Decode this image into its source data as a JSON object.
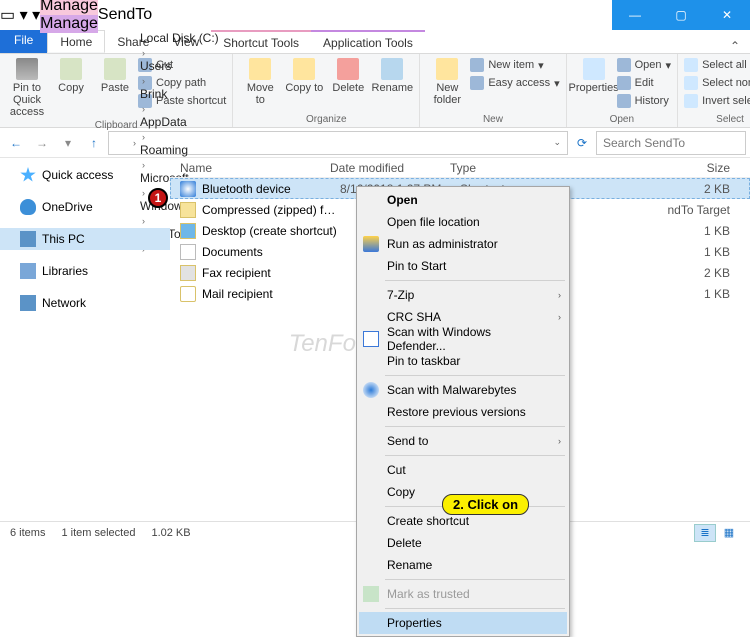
{
  "window": {
    "title": "SendTo",
    "ctx_tab_1": "Manage",
    "ctx_tab_2": "Manage"
  },
  "tabs": {
    "file": "File",
    "home": "Home",
    "share": "Share",
    "view": "View",
    "shortcut": "Shortcut Tools",
    "app": "Application Tools"
  },
  "ribbon": {
    "clipboard": {
      "label": "Clipboard",
      "pin": "Pin to Quick access",
      "copy": "Copy",
      "paste": "Paste",
      "cut": "Cut",
      "copypath": "Copy path",
      "pasteshort": "Paste shortcut"
    },
    "organize": {
      "label": "Organize",
      "moveto": "Move to",
      "copyto": "Copy to",
      "delete": "Delete",
      "rename": "Rename"
    },
    "new": {
      "label": "New",
      "newfolder": "New folder",
      "newitem": "New item",
      "easy": "Easy access"
    },
    "open": {
      "label": "Open",
      "properties": "Properties",
      "open": "Open",
      "edit": "Edit",
      "history": "History"
    },
    "select": {
      "label": "Select",
      "all": "Select all",
      "none": "Select none",
      "invert": "Invert selection"
    }
  },
  "breadcrumb": [
    "Local Disk (C:)",
    "Users",
    "Brink",
    "AppData",
    "Roaming",
    "Microsoft",
    "Windows",
    "SendTo"
  ],
  "search_placeholder": "Search SendTo",
  "nav": {
    "quick": "Quick access",
    "onedrive": "OneDrive",
    "thispc": "This PC",
    "libraries": "Libraries",
    "network": "Network"
  },
  "columns": {
    "name": "Name",
    "date": "Date modified",
    "type": "Type",
    "size": "Size"
  },
  "files": [
    {
      "name": "Bluetooth device",
      "date": "8/16/2018 1:27 PM",
      "type": "Shortcut",
      "size": "2 KB",
      "icon": "bt",
      "sel": true
    },
    {
      "name": "Compressed (zipped) folder",
      "date": "",
      "type": "",
      "size": "ndTo Target",
      "icon": "zip"
    },
    {
      "name": "Desktop (create shortcut)",
      "date": "",
      "type": "",
      "size": "1 KB",
      "icon": "desk"
    },
    {
      "name": "Documents",
      "date": "",
      "type": "",
      "size": "1 KB",
      "icon": "doc"
    },
    {
      "name": "Fax recipient",
      "date": "",
      "type": "",
      "size": "2 KB",
      "icon": "fax"
    },
    {
      "name": "Mail recipient",
      "date": "",
      "type": "",
      "size": "1 KB",
      "icon": "mail"
    }
  ],
  "context": {
    "open": "Open",
    "openloc": "Open file location",
    "runadmin": "Run as administrator",
    "pinstart": "Pin to Start",
    "sevenzip": "7-Zip",
    "crcsha": "CRC SHA",
    "defender": "Scan with Windows Defender...",
    "pintask": "Pin to taskbar",
    "malware": "Scan with Malwarebytes",
    "restore": "Restore previous versions",
    "sendto": "Send to",
    "cut": "Cut",
    "copy": "Copy",
    "createshort": "Create shortcut",
    "delete": "Delete",
    "rename": "Rename",
    "marktrusted": "Mark as trusted",
    "properties": "Properties"
  },
  "annotation": {
    "step1": "1",
    "step2": "2.  Click on"
  },
  "status": {
    "count": "6 items",
    "sel": "1 item selected",
    "size": "1.02 KB"
  },
  "watermark": "TenForums.com"
}
